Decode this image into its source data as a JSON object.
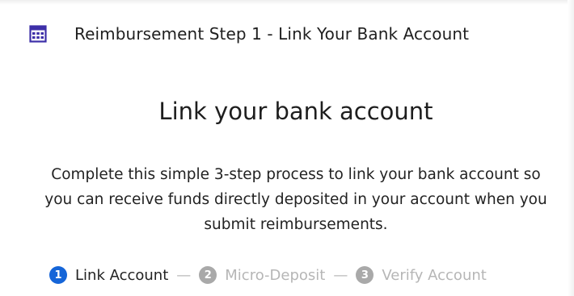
{
  "header": {
    "icon": "calculator-icon",
    "title": "Reimbursement Step 1 - Link Your Bank Account"
  },
  "main": {
    "title": "Link your bank account",
    "description": "Complete this simple 3-step process to link your bank account so you can receive funds directly deposited in your account when you submit reimbursements."
  },
  "stepper": {
    "separator": "—",
    "steps": [
      {
        "number": "1",
        "label": "Link Account",
        "state": "active"
      },
      {
        "number": "2",
        "label": "Micro-Deposit",
        "state": "inactive"
      },
      {
        "number": "3",
        "label": "Verify Account",
        "state": "inactive"
      }
    ]
  },
  "colors": {
    "accent": "#1565d8",
    "inactive_step": "#a9a9a9",
    "icon": "#3d2fa8"
  }
}
